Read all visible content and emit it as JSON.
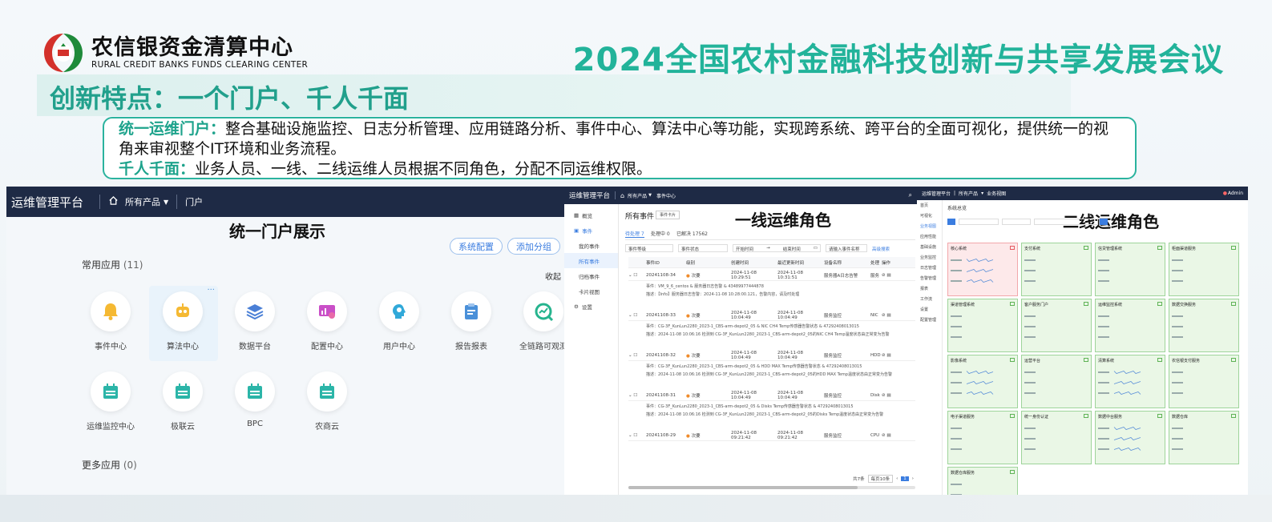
{
  "logo": {
    "name_cn": "农信银资金清算中心",
    "name_en": "RURAL CREDIT BANKS FUNDS CLEARING CENTER",
    "colors": {
      "red": "#d3312b",
      "green": "#1e8a3a"
    }
  },
  "conference": {
    "title": "2024全国农村金融科技创新与共享发展会议",
    "color": "#22b39a"
  },
  "slide_title": "创新特点：一个门户、千人千面",
  "features": [
    {
      "label": "统一运维门户：",
      "text": "整合基础设施监控、日志分析管理、应用链路分析、事件中心、算法中心等功能，实现跨系统、跨平台的全面可视化，提供统一的视角来审视整个IT环境和业务流程。"
    },
    {
      "label": "千人千面：",
      "text": "业务人员、一线、二线运维人员根据不同角色，分配不同运维权限。"
    }
  ],
  "portal": {
    "brand": "运维管理平台",
    "product_menu": "所有产品",
    "nav_portal": "门户",
    "caption": "统一门户展示",
    "buttons": [
      "系统配置",
      "添加分组"
    ],
    "common_apps_label": "常用应用",
    "common_apps_count": "(11)",
    "collapse": "收起",
    "more_apps_label": "更多应用",
    "more_apps_count": "(0)",
    "apps_row1": [
      {
        "label": "事件中心",
        "icon": "bell-icon",
        "color": "#f5b933"
      },
      {
        "label": "算法中心",
        "icon": "robot-icon",
        "color": "#f5b933"
      },
      {
        "label": "数据平台",
        "icon": "layers-icon",
        "color": "#4a7fd6"
      },
      {
        "label": "配置中心",
        "icon": "config-icon",
        "color": "#c94fc7"
      },
      {
        "label": "用户中心",
        "icon": "user-head-icon",
        "color": "#31a9d9"
      },
      {
        "label": "报告报表",
        "icon": "clipboard-icon",
        "color": "#4a90d9"
      },
      {
        "label": "全链路可观测",
        "icon": "chart-search-icon",
        "color": "#26b48e"
      }
    ],
    "apps_row2": [
      {
        "label": "运维监控中心",
        "icon": "calendar-icon",
        "color": "#2bb5a8"
      },
      {
        "label": "极联云",
        "icon": "calendar-icon",
        "color": "#2bb5a8"
      },
      {
        "label": "BPC",
        "icon": "calendar-icon",
        "color": "#2bb5a8"
      },
      {
        "label": "农商云",
        "icon": "calendar-icon",
        "color": "#2bb5a8"
      }
    ]
  },
  "frontline": {
    "brand": "运维管理平台",
    "product_menu": "所有产品",
    "nav_event": "事件中心",
    "caption": "一线运维角色",
    "sidebar": [
      "概览",
      "事件",
      "我的事件",
      "所有事件",
      "归档事件",
      "卡片视图",
      "设置"
    ],
    "page_title": "所有事件",
    "view_toggle": "事件卡片",
    "tabs": [
      "待处理 7",
      "处理中 0",
      "已解决 17562"
    ],
    "filters": [
      "事件等级",
      "事件状态",
      "开始时间",
      "结束时间",
      "请输入事件名称",
      "高级搜索"
    ],
    "columns": [
      "事件ID",
      "级别",
      "创建时间",
      "最近更新时间",
      "设备名称",
      "处理",
      "操作"
    ],
    "rows": [
      {
        "id": "20241108-34",
        "level": "次要",
        "created": "2024-11-08 10:29:51",
        "updated": "2024-11-08 10:31:51",
        "device": "服务器A日志告警",
        "src": "服务",
        "d1": "事件：VM_9_6_centos & 服务器日志告警 & 43489977444878",
        "d2": "描述：【Info】服务器日志告警：2024-11-08 10:28:00.121，告警内容，请及时处理"
      },
      {
        "id": "20241108-33",
        "level": "次要",
        "created": "2024-11-08 10:04:49",
        "updated": "2024-11-08 10:04:49",
        "device": "服务监控",
        "src": "NIC",
        "d1": "事件：CG-3F_KunLun2280_2023-1_CBS-arm-depot2_05 & NIC CH4 Temp传感器告警状态 & 47292408013015",
        "d2": "描述：2024-11-08 10:06:16 检测到 CG-3F_KunLun2280_2023-1_CBS-arm-depot2_05的NIC CH4 Temp温度状态由正常变为告警"
      },
      {
        "id": "20241108-32",
        "level": "次要",
        "created": "2024-11-08 10:04:49",
        "updated": "2024-11-08 10:04:49",
        "device": "服务监控",
        "src": "HDD",
        "d1": "事件：CG-3F_KunLun2280_2023-1_CBS-arm-depot2_05 & HDD MAX Temp传感器告警状态 & 47292408013015",
        "d2": "描述：2024-11-08 10:06:16 检测到 CG-3F_KunLun2280_2023-1_CBS-arm-depot2_05的HDD MAX Temp温度状态由正常变为告警"
      },
      {
        "id": "20241108-31",
        "level": "次要",
        "created": "2024-11-08 10:04:49",
        "updated": "2024-11-08 10:04:49",
        "device": "服务监控",
        "src": "Disk",
        "d1": "事件：CG-3F_KunLun2280_2023-1_CBS-arm-depot2_05 & Disks Temp传感器告警状态 & 47292408013015",
        "d2": "描述：2024-11-08 10:06:16 检测到 CG-3F_KunLun2280_2023-1_CBS-arm-depot2_05的Disks Temp温度状态由正常变为告警"
      },
      {
        "id": "20241108-29",
        "level": "次要",
        "created": "2024-11-08 09:21:42",
        "updated": "2024-11-08 09:21:42",
        "device": "服务监控",
        "src": "CPU",
        "d1": "",
        "d2": ""
      }
    ],
    "pagination": {
      "total": "共7条",
      "per_page": "每页10条",
      "page": "1"
    }
  },
  "secondline": {
    "brand": "运维管理平台",
    "product_menu": "所有产品",
    "nav": "业务视图",
    "user": "Admin",
    "caption": "二线运维角色",
    "sidebar": [
      "首页",
      "可视化",
      "业务视图",
      "应用性能",
      "基础设施",
      "业务监控",
      "日志管理",
      "告警管理",
      "报表",
      "工作流",
      "设置",
      "配置管理"
    ],
    "section_title": "系统总览",
    "cards": [
      {
        "title": "核心系统",
        "status": "red"
      },
      {
        "title": "支付系统",
        "status": "green"
      },
      {
        "title": "信贷管理系统",
        "status": "green"
      },
      {
        "title": "柜面渠道服务",
        "status": "green"
      },
      {
        "title": "渠道管理系统",
        "status": "green"
      },
      {
        "title": "客户服务门户",
        "status": "green"
      },
      {
        "title": "运维监控系统",
        "status": "green"
      },
      {
        "title": "数据交换服务",
        "status": "green"
      },
      {
        "title": "影像系统",
        "status": "green"
      },
      {
        "title": "运营平台",
        "status": "green"
      },
      {
        "title": "清算系统",
        "status": "green"
      },
      {
        "title": "农信银支付服务",
        "status": "green"
      },
      {
        "title": "电子渠道服务",
        "status": "green"
      },
      {
        "title": "统一身份认证",
        "status": "green"
      },
      {
        "title": "数据中台服务",
        "status": "green"
      },
      {
        "title": "数据仓库",
        "status": "green"
      },
      {
        "title": "数据仓库服务",
        "status": "green"
      }
    ]
  }
}
